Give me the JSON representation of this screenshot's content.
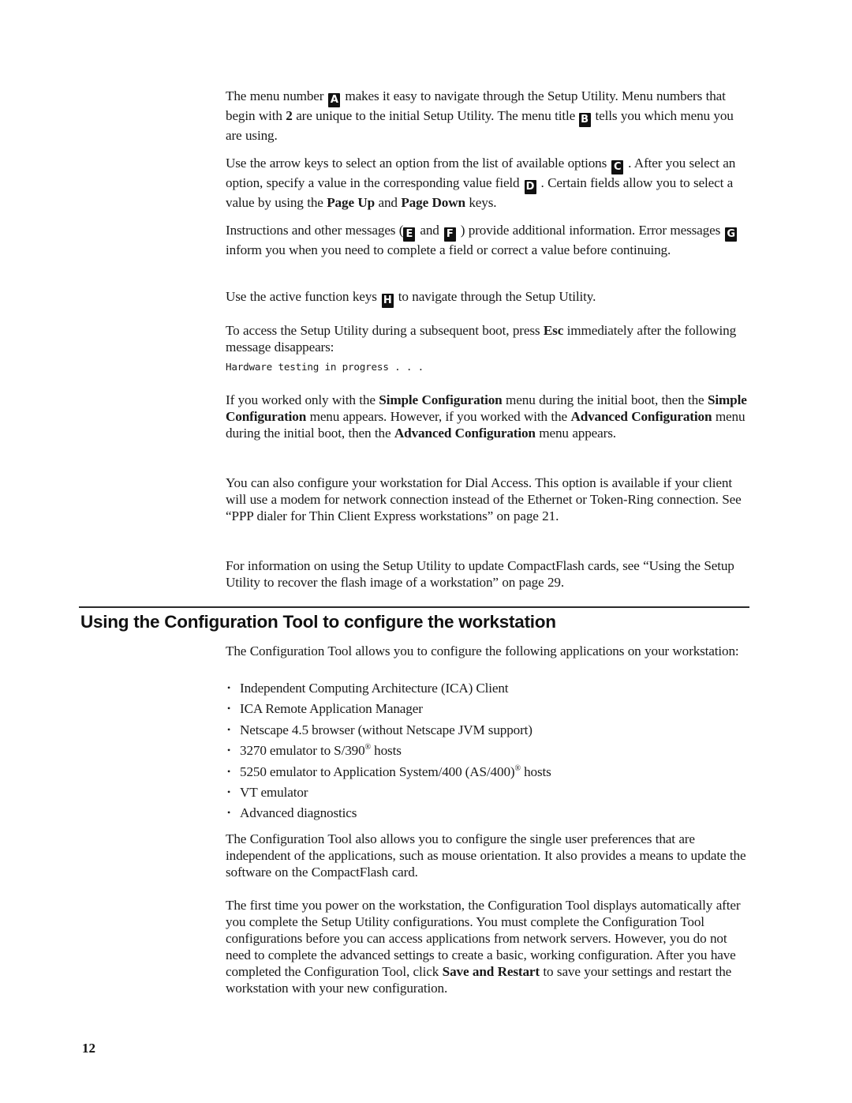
{
  "document": {
    "page_number": "12",
    "markers": {
      "A": "A",
      "B": "B",
      "C": "C",
      "D": "D",
      "E": "E",
      "F": "F",
      "G": "G",
      "H": "H"
    },
    "paragraphs": {
      "menu_number": {
        "t1": "The menu number",
        "t2": "makes it easy to navigate through the Setup Utility. Menu numbers that begin with",
        "bold1": "2",
        "t3": "are unique to the initial Setup Utility. The menu title",
        "t4": "tells you which menu you are using."
      },
      "arrow_keys": {
        "t1": "Use the arrow keys to select an option from the list of available options",
        "t2": ". After you select an option, specify a value in the corresponding value field",
        "t3": ". Certain fields allow you to select a value by using the",
        "bold1": "Page Up",
        "t4": "and",
        "bold2": "Page Down",
        "t5": "keys."
      },
      "instructions": {
        "t1": "Instructions and other messages (",
        "t2": "and",
        "t3": ") provide additional information. Error messages",
        "t4": "inform you when you need to complete a field or correct a value before continuing."
      },
      "function_keys": {
        "t1": "Use the active function keys",
        "t2": "to navigate through the Setup Utility."
      },
      "subsequent_boot": {
        "t1": "To access the Setup Utility during a subsequent boot, press",
        "bold1": "Esc",
        "t2": "immediately after the following message disappears:"
      },
      "boot_message": "Hardware testing in progress . . .",
      "simple_config": {
        "t1": "If you worked only with the",
        "bold1": "Simple Configuration",
        "t2": "menu during the initial boot, then the",
        "bold2": "Simple Configuration",
        "t3": "menu appears. However, if you worked with the",
        "bold3": "Advanced Configuration",
        "t4": "menu during the initial boot, then the",
        "bold4": "Advanced Configuration",
        "t5": "menu appears."
      },
      "dial_access": "You can also configure your workstation for Dial Access. This option is available if your client will use a modem for network connection instead of the Ethernet or Token-Ring connection. See “PPP dialer for Thin Client Express workstations” on page 21.",
      "compactflash": "For information on using the Setup Utility to update CompactFlash cards, see “Using the Setup Utility to recover the flash image of a workstation” on page 29."
    },
    "section": {
      "heading": "Using the Configuration Tool to configure the workstation",
      "intro": "The Configuration Tool allows you to configure the following applications on your workstation:",
      "bullet_glyph": "•",
      "bullets": [
        {
          "text": "Independent Computing Architecture (ICA) Client",
          "sup": "",
          "after": ""
        },
        {
          "text": "ICA Remote Application Manager",
          "sup": "",
          "after": ""
        },
        {
          "text": "Netscape 4.5 browser (without Netscape JVM support)",
          "sup": "",
          "after": ""
        },
        {
          "text": "3270 emulator to S/390",
          "sup": "®",
          "after": " hosts"
        },
        {
          "text": "5250 emulator to Application System/400 (AS/400)",
          "sup": "®",
          "after": " hosts"
        },
        {
          "text": "VT emulator",
          "sup": "",
          "after": ""
        },
        {
          "text": "Advanced diagnostics",
          "sup": "",
          "after": ""
        }
      ],
      "preferences": "The Configuration Tool also allows you to configure the single user preferences that are independent of the applications, such as mouse orientation. It also provides a means to update the software on the CompactFlash card.",
      "first_time": {
        "t1": "The first time you power on the workstation, the Configuration Tool displays automatically after you complete the Setup Utility configurations. You must complete the Configuration Tool configurations before you can access applications from network servers. However, you do not need to complete the advanced settings to create a basic, working configuration. After you have completed the Configuration Tool, click",
        "bold1": "Save and Restart",
        "t2": "to save your settings and restart the workstation with your new configuration."
      }
    }
  }
}
